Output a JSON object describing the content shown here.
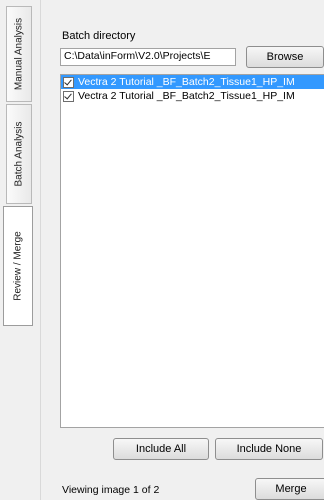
{
  "tabs": [
    {
      "label": "Manual Analysis",
      "active": false
    },
    {
      "label": "Batch Analysis",
      "active": false
    },
    {
      "label": "Review / Merge",
      "active": true
    }
  ],
  "batch": {
    "label": "Batch directory",
    "path": "C:\\Data\\inForm\\V2.0\\Projects\\E",
    "browse_label": "Browse"
  },
  "files": [
    {
      "name": "Vectra 2 Tutorial _BF_Batch2_Tissue1_HP_IM",
      "checked": true,
      "selected": true
    },
    {
      "name": "Vectra 2 Tutorial _BF_Batch2_Tissue1_HP_IM",
      "checked": true,
      "selected": false
    }
  ],
  "buttons": {
    "include_all": "Include All",
    "include_none": "Include None",
    "merge": "Merge"
  },
  "status": {
    "viewing": "Viewing image 1 of 2"
  },
  "colors": {
    "selection": "#3399ff"
  }
}
